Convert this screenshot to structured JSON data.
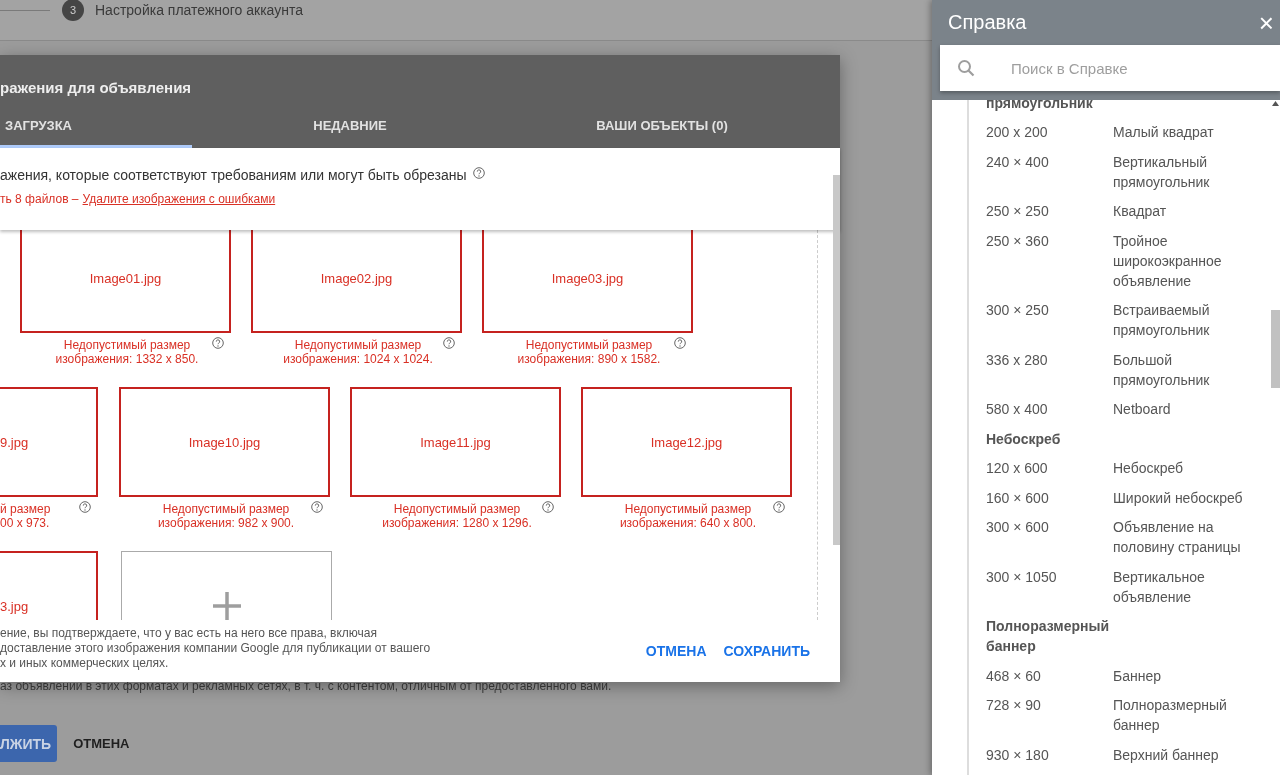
{
  "background_page": {
    "step": {
      "number": "3",
      "label": "Настройка платежного аккаунта"
    },
    "notice": "аз объявлений в этих форматах и рекламных сетях, в т. ч. с контентом, отличным от предоставленного вами.",
    "buttons": [
      {
        "label": "ЛЖИТЬ",
        "kind": "primary"
      },
      {
        "label": "ОТМЕНА",
        "kind": "text"
      }
    ]
  },
  "dialog": {
    "title": "ражения для объявления",
    "tabs": [
      {
        "label": "ЗАГРУЗКА",
        "selected": true
      },
      {
        "label": "НЕДАВНИЕ",
        "selected": false
      },
      {
        "label": "ВАШИ ОБЪЕКТЫ (0)",
        "selected": false
      }
    ],
    "requirements": "ажения, которые соответствуют требованиям или могут быть обрезаны",
    "error_summary": "ть 8 файлов –",
    "error_link": "Удалите изображения с ошибками",
    "image_rows": [
      [
        {
          "kind": "error",
          "name": "Image01.jpg",
          "error": "Недопустимый размер изображения: 1332 x 850."
        },
        {
          "kind": "error",
          "name": "Image02.jpg",
          "error": "Недопустимый размер изображения: 1024 x 1024."
        },
        {
          "kind": "error",
          "name": "Image03.jpg",
          "error": "Недопустимый размер изображения: 890 x 1582."
        }
      ],
      [
        {
          "kind": "cut",
          "name": "9.jpg",
          "error": "й размер\n00 x 973."
        },
        {
          "kind": "error",
          "name": "Image10.jpg",
          "error": "Недопустимый размер изображения: 982 x 900."
        },
        {
          "kind": "error",
          "name": "Image11.jpg",
          "error": "Недопустимый размер изображения: 1280 x 1296."
        },
        {
          "kind": "error",
          "name": "Image12.jpg",
          "error": "Недопустимый размер изображения: 640 x 800."
        }
      ],
      [
        {
          "kind": "cut",
          "name": "3.jpg"
        },
        {
          "kind": "add"
        }
      ]
    ],
    "footer_text": "ение, вы подтверждаете, что у вас есть на него все права, включая\nдоставление этого изображения компании Google для публикации от вашего\nх и иных коммерческих целях.",
    "buttons": [
      {
        "label": "ОТМЕНА"
      },
      {
        "label": "СОХРАНИТЬ"
      }
    ]
  },
  "help": {
    "title": "Справка",
    "close": "×",
    "search": {
      "placeholder": "Поиск в Справке"
    },
    "entries": [
      {
        "kind": "heading",
        "text": "прямоугольник"
      },
      {
        "kind": "size",
        "size": "200 x 200",
        "name": "Малый квадрат"
      },
      {
        "kind": "size",
        "size": "240 × 400",
        "name": "Вертикальный прямоугольник"
      },
      {
        "kind": "size",
        "size": "250 × 250",
        "name": "Квадрат"
      },
      {
        "kind": "size",
        "size": "250 × 360",
        "name": "Тройное широкоэкранное объявление"
      },
      {
        "kind": "size",
        "size": "300 × 250",
        "name": "Встраиваемый прямоугольник"
      },
      {
        "kind": "size",
        "size": "336 x 280",
        "name": "Большой прямоугольник"
      },
      {
        "kind": "size",
        "size": "580 x 400",
        "name": "Netboard"
      },
      {
        "kind": "heading",
        "text": "Небоскреб"
      },
      {
        "kind": "size",
        "size": "120 x 600",
        "name": "Небоскреб"
      },
      {
        "kind": "size",
        "size": "160 × 600",
        "name": "Широкий небоскреб"
      },
      {
        "kind": "size",
        "size": "300 × 600",
        "name": "Объявление на половину страницы"
      },
      {
        "kind": "size",
        "size": "300 × 1050",
        "name": "Вертикальное объявление"
      },
      {
        "kind": "heading",
        "text": "Полноразмерный баннер"
      },
      {
        "kind": "size",
        "size": "468 × 60",
        "name": "Баннер"
      },
      {
        "kind": "size",
        "size": "728 × 90",
        "name": "Полноразмерный баннер"
      },
      {
        "kind": "size",
        "size": "930 × 180",
        "name": "Верхний баннер"
      }
    ]
  }
}
